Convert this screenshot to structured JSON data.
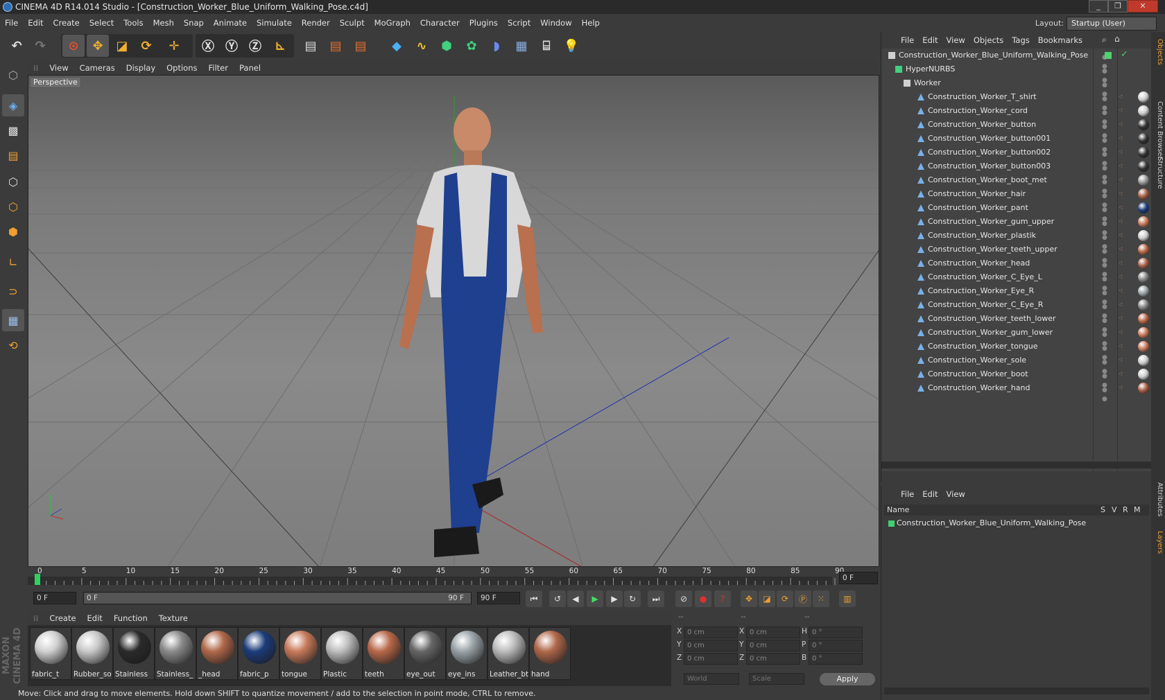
{
  "window": {
    "title": "CINEMA 4D R14.014 Studio - [Construction_Worker_Blue_Uniform_Walking_Pose.c4d]"
  },
  "menubar": [
    "File",
    "Edit",
    "Create",
    "Select",
    "Tools",
    "Mesh",
    "Snap",
    "Animate",
    "Simulate",
    "Render",
    "Sculpt",
    "MoGraph",
    "Character",
    "Plugins",
    "Script",
    "Window",
    "Help"
  ],
  "layout": {
    "label": "Layout:",
    "value": "Startup (User)"
  },
  "viewport": {
    "menu": [
      "View",
      "Cameras",
      "Display",
      "Options",
      "Filter",
      "Panel"
    ],
    "label": "Perspective"
  },
  "timeline": {
    "ticks": [
      "0",
      "5",
      "10",
      "15",
      "20",
      "25",
      "30",
      "35",
      "40",
      "45",
      "50",
      "55",
      "60",
      "65",
      "70",
      "75",
      "80",
      "85",
      "90"
    ],
    "current_frame": "0 F",
    "start_field": "0 F",
    "range_start": "0 F",
    "range_end": "90 F",
    "end_field": "90 F"
  },
  "materials": {
    "menu": [
      "Create",
      "Edit",
      "Function",
      "Texture"
    ],
    "items": [
      {
        "label": "fabric_t",
        "color": "#d0d0d0"
      },
      {
        "label": "Rubber_so",
        "color": "#c8c8c8"
      },
      {
        "label": "Stainless",
        "color": "#2a2a2a"
      },
      {
        "label": "Stainless_",
        "color": "#8a8a8a"
      },
      {
        "label": "_head",
        "color": "#b0684a"
      },
      {
        "label": "fabric_p",
        "color": "#1c3c7a"
      },
      {
        "label": "tongue",
        "color": "#c87a5a"
      },
      {
        "label": "Plastic",
        "color": "#bdbdbd"
      },
      {
        "label": "teeth",
        "color": "#b8684a"
      },
      {
        "label": "eye_out",
        "color": "#666666"
      },
      {
        "label": "eye_ins",
        "color": "#9aa3a8"
      },
      {
        "label": "Leather_bt",
        "color": "#bcbcbc"
      },
      {
        "label": "hand",
        "color": "#b0684a"
      }
    ]
  },
  "coords": {
    "headers": [
      "--",
      "--",
      "--"
    ],
    "rows": [
      {
        "a": "X",
        "av": "0 cm",
        "b": "X",
        "bv": "0 cm",
        "c": "H",
        "cv": "0 °"
      },
      {
        "a": "Y",
        "av": "0 cm",
        "b": "Y",
        "bv": "0 cm",
        "c": "P",
        "cv": "0 °"
      },
      {
        "a": "Z",
        "av": "0 cm",
        "b": "Z",
        "bv": "0 cm",
        "c": "B",
        "cv": "0 °"
      }
    ],
    "mode1": "World",
    "mode2": "Scale",
    "apply": "Apply"
  },
  "status": "Move: Click and drag to move elements. Hold down SHIFT to quantize movement / add to the selection in point mode, CTRL to remove.",
  "objects": {
    "menu": [
      "File",
      "Edit",
      "View",
      "Objects",
      "Tags",
      "Bookmarks"
    ],
    "root": "Construction_Worker_Blue_Uniform_Walking_Pose",
    "hypernurbs": "HyperNURBS",
    "group": "Worker",
    "items": [
      {
        "name": "Construction_Worker_T_shirt",
        "tag": "#cfcfcf"
      },
      {
        "name": "Construction_Worker_cord",
        "tag": "#cfcfcf"
      },
      {
        "name": "Construction_Worker_button",
        "tag": "#333333"
      },
      {
        "name": "Construction_Worker_button001",
        "tag": "#333333"
      },
      {
        "name": "Construction_Worker_button002",
        "tag": "#333333"
      },
      {
        "name": "Construction_Worker_button003",
        "tag": "#333333"
      },
      {
        "name": "Construction_Worker_boot_met",
        "tag": "#999999"
      },
      {
        "name": "Construction_Worker_hair",
        "tag": "#a86048"
      },
      {
        "name": "Construction_Worker_pant",
        "tag": "#1c3c7a"
      },
      {
        "name": "Construction_Worker_gum_upper",
        "tag": "#c87a5a"
      },
      {
        "name": "Construction_Worker_plastik",
        "tag": "#cfcfcf"
      },
      {
        "name": "Construction_Worker_teeth_upper",
        "tag": "#b86848"
      },
      {
        "name": "Construction_Worker_head",
        "tag": "#a86048"
      },
      {
        "name": "Construction_Worker_C_Eye_L",
        "tag": "#888888"
      },
      {
        "name": "Construction_Worker_Eye_R",
        "tag": "#9aa3a8"
      },
      {
        "name": "Construction_Worker_C_Eye_R",
        "tag": "#888888"
      },
      {
        "name": "Construction_Worker_teeth_lower",
        "tag": "#b86848"
      },
      {
        "name": "Construction_Worker_gum_lower",
        "tag": "#c87a5a"
      },
      {
        "name": "Construction_Worker_tongue",
        "tag": "#c87a5a"
      },
      {
        "name": "Construction_Worker_sole",
        "tag": "#cfcfcf"
      },
      {
        "name": "Construction_Worker_boot",
        "tag": "#cfcfcf"
      },
      {
        "name": "Construction_Worker_hand",
        "tag": "#a86048"
      }
    ]
  },
  "layers": {
    "menu": [
      "File",
      "Edit",
      "View"
    ],
    "cols": [
      "Name",
      "S",
      "V",
      "R",
      "M"
    ],
    "row": "Construction_Worker_Blue_Uniform_Walking_Pose"
  },
  "sidetabs": [
    "Objects",
    "Content Browser",
    "Structure",
    "Attributes",
    "Layers"
  ],
  "brand": "MAXON CINEMA 4D"
}
